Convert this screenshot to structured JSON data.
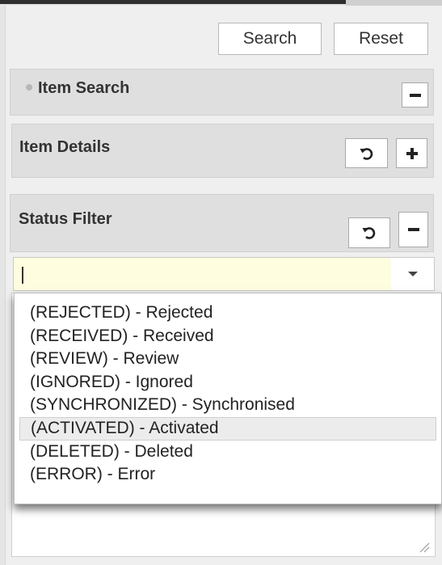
{
  "toolbar": {
    "search_label": "Search",
    "reset_label": "Reset"
  },
  "sections": {
    "item_search": {
      "title": "Item Search",
      "toggle_icon": "minus-icon"
    },
    "item_details": {
      "title": "Item Details",
      "refresh_icon": "refresh-icon",
      "toggle_icon": "plus-icon"
    },
    "status_filter": {
      "title": "Status Filter",
      "refresh_icon": "refresh-icon",
      "toggle_icon": "minus-icon"
    }
  },
  "status_combo": {
    "value": "",
    "arrow_icon": "chevron-down-icon",
    "background": "#fffde0"
  },
  "dropdown": {
    "options": [
      "(REJECTED) - Rejected",
      "(RECEIVED) - Received",
      "(REVIEW) - Review",
      "(IGNORED) - Ignored",
      "(SYNCHRONIZED) - Synchronised",
      "(ACTIVATED) - Activated",
      "(DELETED) - Deleted",
      "(ERROR) - Error"
    ],
    "highlighted": "(ACTIVATED) - Activated"
  }
}
